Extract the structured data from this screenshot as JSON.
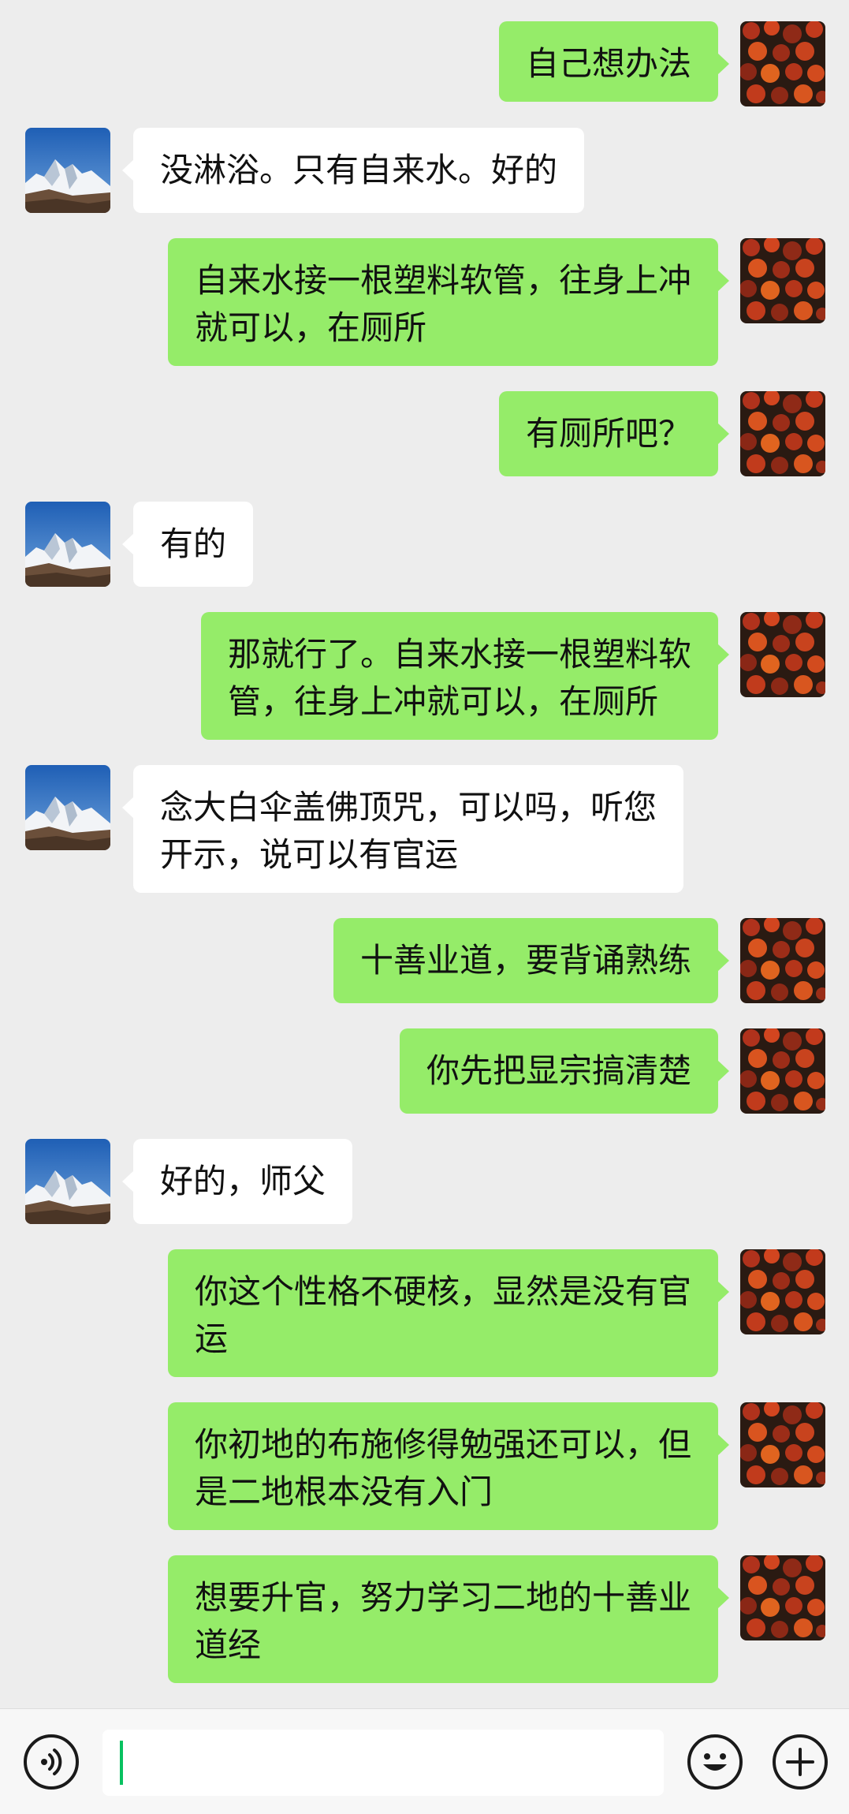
{
  "messages": [
    {
      "side": "out",
      "text": "自己想办法"
    },
    {
      "side": "in",
      "text": "没淋浴。只有自来水。好的"
    },
    {
      "side": "out",
      "text": "自来水接一根塑料软管，往身上冲\n就可以，在厕所"
    },
    {
      "side": "out",
      "text": "有厕所吧？"
    },
    {
      "side": "in",
      "text": "有的"
    },
    {
      "side": "out",
      "text": "那就行了。自来水接一根塑料软\n管，往身上冲就可以，在厕所"
    },
    {
      "side": "in",
      "text": "念大白伞盖佛顶咒，可以吗，听您\n开示，说可以有官运"
    },
    {
      "side": "out",
      "text": "十善业道，要背诵熟练"
    },
    {
      "side": "out",
      "text": "你先把显宗搞清楚"
    },
    {
      "side": "in",
      "text": "好的，师父"
    },
    {
      "side": "out",
      "text": "你这个性格不硬核，显然是没有官\n运"
    },
    {
      "side": "out",
      "text": "你初地的布施修得勉强还可以，但\n是二地根本没有入门"
    },
    {
      "side": "out",
      "text": "想要升官，努力学习二地的十善业\n道经"
    }
  ],
  "input_bar": {
    "voice_icon": "voice-icon",
    "emoji_icon": "emoji-icon",
    "plus_icon": "plus-icon",
    "text": ""
  },
  "colors": {
    "background": "#ededed",
    "outgoing_bubble": "#95ec69",
    "incoming_bubble": "#ffffff",
    "caret": "#07c160"
  }
}
